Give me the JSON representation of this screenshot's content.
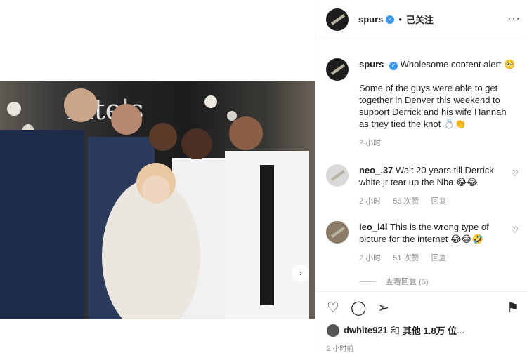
{
  "header": {
    "username": "spurs",
    "separator": "•",
    "follow_state": "已关注",
    "more": "···"
  },
  "caption": {
    "username": "spurs",
    "title": "Wholesome content alert 🥺",
    "text": "Some of the guys were able to get together in Denver this weekend to support Derrick and his wife Hannah as they tied the knot 💍👏",
    "time": "2 小时"
  },
  "comments": [
    {
      "username": "neo_.37",
      "text": "Wait 20 years till Derrick white jr tear up the Nba 😂😂",
      "time": "2 小时",
      "likes": "56 次赞",
      "reply": "回复"
    },
    {
      "username": "leo_l4l",
      "text": "This is the wrong type of picture for the internet 😂😂🤣",
      "time": "2 小时",
      "likes": "51 次赞",
      "reply": "回复"
    }
  ],
  "view_replies": "查看回复 (5)",
  "likes_line": {
    "user": "dwhite921",
    "and": "和",
    "others": "其他 1.8万 位",
    "suffix": "..."
  },
  "post_time": "2 小时前",
  "icons": {
    "like": "heart-icon",
    "comment": "comment-icon",
    "share": "share-icon",
    "save": "bookmark-icon"
  }
}
